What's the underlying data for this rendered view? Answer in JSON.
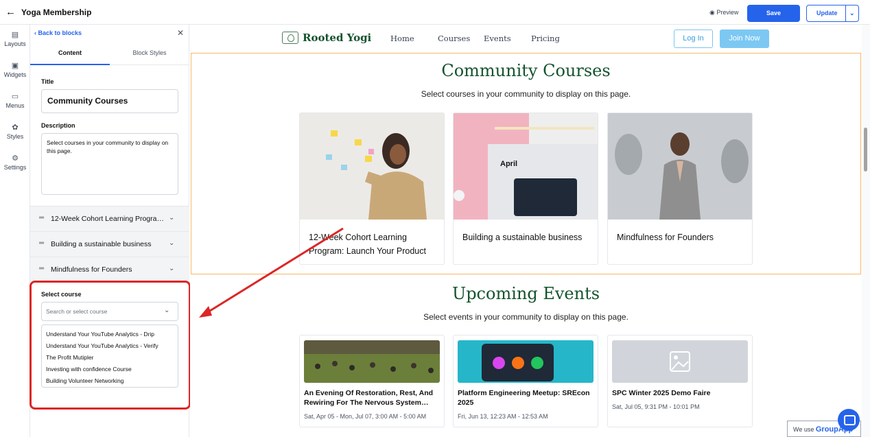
{
  "topbar": {
    "back_glyph": "←",
    "title": "Yoga Membership",
    "preview_label": "Preview",
    "save_label": "Save",
    "update_label": "Update"
  },
  "rail": {
    "items": [
      {
        "label": "Layouts",
        "icon": "layouts-icon"
      },
      {
        "label": "Widgets",
        "icon": "widgets-icon"
      },
      {
        "label": "Menus",
        "icon": "menus-icon"
      },
      {
        "label": "Styles",
        "icon": "palette-icon"
      },
      {
        "label": "Settings",
        "icon": "gear-icon"
      }
    ]
  },
  "panel": {
    "back_label": "Back to blocks",
    "tabs": [
      "Content",
      "Block Styles"
    ],
    "title_label": "Title",
    "title_value": "Community Courses",
    "description_label": "Description",
    "description_value": "Select courses in your community to display on this page.",
    "courses": [
      "12-Week Cohort Learning Program: Launch Your Product",
      "Building a sustainable business",
      "Mindfulness for Founders"
    ],
    "select_label": "Select course",
    "select_placeholder": "Search or select course",
    "options": [
      "Understand Your YouTube Analytics - Drip",
      "Understand Your YouTube Analytics - Verify",
      "The Profit Mutipler",
      "Investing with confidence Course",
      "Building Volunteer Networking"
    ]
  },
  "site": {
    "logo_name": "Rooted Yogi",
    "nav": [
      "Home",
      "Courses",
      "Events",
      "Pricing"
    ],
    "login_label": "Log In",
    "join_label": "Join Now",
    "courses_section": {
      "title": "Community Courses",
      "subtitle": "Select courses in your community to display on this page.",
      "cards": [
        "12-Week Cohort Learning Program: Launch Your Product",
        "Building a sustainable business",
        "Mindfulness for Founders"
      ]
    },
    "events_section": {
      "title": "Upcoming Events",
      "subtitle": "Select events in your community to display on this page.",
      "cards": [
        {
          "title": "An Evening Of Restoration, Rest, And Rewiring For The Nervous System…",
          "date": "Sat, Apr 05 - Mon, Jul 07, 3:00 AM - 5:00 AM"
        },
        {
          "title": "Platform Engineering Meetup: SREcon 2025",
          "date": "Fri, Jun 13, 12:23 AM - 12:53 AM"
        },
        {
          "title": "SPC Winter 2025 Demo Faire",
          "date": "Sat, Jul 05, 9:31 PM - 10:01 PM"
        }
      ]
    },
    "calendar_month": "April"
  },
  "cookie_text": "We use",
  "cookie_brand": "GroupApp",
  "colors": {
    "accent": "#2563eb",
    "brand_green": "#14532d",
    "highlight_red": "#dc2626",
    "selection_orange": "#f5b96a",
    "join_blue": "#7cc8f3"
  }
}
